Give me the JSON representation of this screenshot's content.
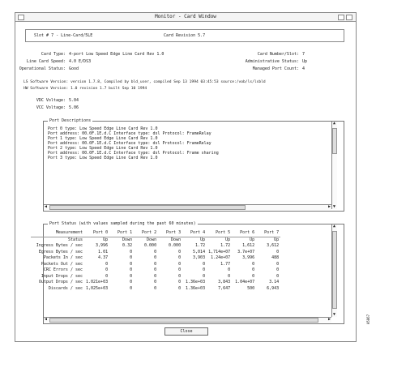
{
  "window": {
    "title": "Monitor - Card Window"
  },
  "header": {
    "slot": "Slot # 7 - Line-Card/5LE",
    "card": "Card Revision 5.7"
  },
  "info_left": [
    {
      "label": "Card Type:",
      "value": "4-port Low Speed Edge Line Card Rev 1.0"
    },
    {
      "label": "Line Card Speed:",
      "value": "4.0 E/DS3"
    },
    {
      "label": "Operational Status:",
      "value": "Good"
    }
  ],
  "info_right": [
    {
      "label": "Card Number/Slot:",
      "value": "7"
    },
    {
      "label": "Administrative Status:",
      "value": "Up"
    },
    {
      "label": "Managed Port Count:",
      "value": "4"
    }
  ],
  "software_version": "LS Software Version: version 1.7.8, Compiled by bld_user, compiled Sep 13 1994 03:45:53 source:/vob/ls/lsbld",
  "hw_version": "HW Software Version: 1.0 revision 1.7 built Sep 10 1994",
  "vdc": [
    {
      "label": "VDC Voltage:",
      "value": "5.04"
    },
    {
      "label": "VCC Voltage:",
      "value": "5.06"
    }
  ],
  "port_descriptions": {
    "title": "Port Descriptions",
    "lines": [
      "Port 0 type: Low Speed Edge Line Card Rev 1.0",
      "Port address: 00.0F.1E.d.C    Interface type: dsl          Protocol: FrameRelay",
      "",
      "Port 1 type: Low Speed Edge Line Card Rev 1.0",
      "Port address: 00.0F.1E.d.C    Interface type: dsl          Protocol: FrameRelay",
      "",
      "Port 2 type: Low Speed Edge Line Card Rev 1.0",
      "Port address: 00.0F.1E.d.C    Interface type: dsl          Protocol: Frame sharing",
      "",
      "Port 3 type: Low Speed Edge Line Card Rev 1.0"
    ]
  },
  "port_status": {
    "title": "Port Status (with values sampled during the past 60 minutes)",
    "columns": [
      "Measurement",
      "Port 0",
      "Port 1",
      "Port 2",
      "Port 3",
      "Port 4",
      "Port 5",
      "Port 6",
      "Port 7"
    ],
    "rows": [
      [
        "Status",
        "Up",
        "Down",
        "Down",
        "Down",
        "Up",
        "Up",
        "Up",
        "Up"
      ],
      [
        "Ingress Bytes / sec",
        "3,996",
        "0.32",
        "0.000",
        "0.000",
        "1.72",
        "1.72",
        "1,612",
        "3,612"
      ],
      [
        "Egress Bytes / sec",
        "1.01",
        "0",
        "0",
        "0",
        "5,014",
        "1,714e+07",
        "3.7e+07",
        "0"
      ],
      [
        "Packets In / sec",
        "4.37",
        "0",
        "0",
        "0",
        "3,903",
        "1.24e+07",
        "3,996",
        "488"
      ],
      [
        "Packets Out / sec",
        "0",
        "0",
        "0",
        "0",
        "0",
        "1.77",
        "0",
        "0"
      ],
      [
        "CRC Errors / sec",
        "0",
        "0",
        "0",
        "0",
        "0",
        "0",
        "0",
        "0"
      ],
      [
        "Input Drops / sec",
        "0",
        "0",
        "0",
        "0",
        "0",
        "0",
        "0",
        "0"
      ],
      [
        "Output Drops / sec",
        "1.021e+03",
        "0",
        "0",
        "0",
        "1.36e+03",
        "3,843",
        "1.04e+07",
        "3.14"
      ],
      [
        "Discards / sec",
        "1,025e+03",
        "0",
        "0",
        "0",
        "1.36e+03",
        "7,647",
        "500",
        "6,943"
      ]
    ]
  },
  "buttons": {
    "close": "Close"
  },
  "side_mark": "H5867"
}
